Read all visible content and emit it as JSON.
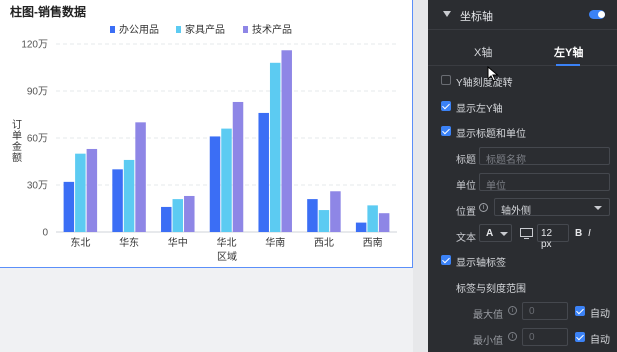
{
  "chart": {
    "title": "柱图-销售数据"
  },
  "chart_data": {
    "type": "bar",
    "title": "柱图-销售数据",
    "xlabel": "区域",
    "ylabel": "订单金额",
    "categories": [
      "东北",
      "华东",
      "华中",
      "华北",
      "华南",
      "西北",
      "西南"
    ],
    "yticks": [
      "0",
      "30万",
      "60万",
      "90万",
      "120万"
    ],
    "ylim": [
      0,
      120
    ],
    "unit": "万",
    "legend_position": "top",
    "series": [
      {
        "name": "办公用品",
        "color": "#3b6ef5",
        "values": [
          32,
          40,
          16,
          61,
          76,
          21,
          6
        ]
      },
      {
        "name": "家具产品",
        "color": "#5ccbf2",
        "values": [
          50,
          46,
          21,
          66,
          108,
          14,
          17
        ]
      },
      {
        "name": "技术产品",
        "color": "#8e86e6",
        "values": [
          53,
          70,
          23,
          83,
          116,
          26,
          12
        ]
      }
    ]
  },
  "panel": {
    "title": "坐标轴",
    "tabs": [
      "X轴",
      "左Y轴"
    ],
    "rotate_label": "Y轴刻度旋转",
    "show_left_y": "显示左Y轴",
    "show_title_unit": "显示标题和单位",
    "title_label": "标题",
    "title_placeholder": "标题名称",
    "unit_label": "单位",
    "unit_placeholder": "单位",
    "position_label": "位置",
    "position_value": "轴外侧",
    "text_label": "文本",
    "font_letter": "A",
    "font_size": "12 px",
    "bold": "B",
    "italic": "I",
    "show_axis_label": "显示轴标签",
    "range_label": "标签与刻度范围",
    "max_label": "最大值",
    "min_label": "最小值",
    "max_value": "0",
    "min_value": "0",
    "auto_label": "自动",
    "accent_color": "#3b82f6"
  }
}
